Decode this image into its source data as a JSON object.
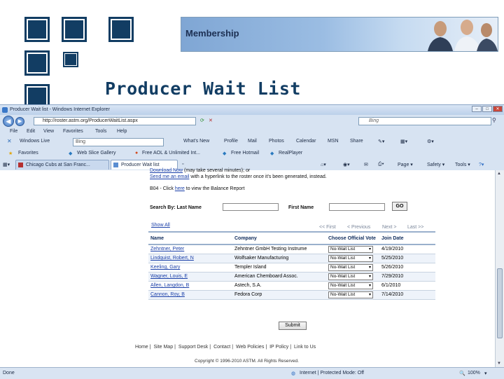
{
  "slide": {
    "banner_title": "Membership",
    "title": "Producer Wait List"
  },
  "browser": {
    "window_title": "Producer Wait list - Windows Internet Explorer",
    "address": "http://roster.astm.org/ProducerWaitList.aspx",
    "search_placeholder": "Bing",
    "menu": [
      "File",
      "Edit",
      "View",
      "Favorites",
      "Tools",
      "Help"
    ],
    "links_box": "Windows Live",
    "links_search": "Bing",
    "links": [
      "What's New",
      "Profile",
      "Mail",
      "Photos",
      "Calendar",
      "MSN",
      "Share"
    ],
    "favorites_label": "Favorites",
    "favorites": [
      "Web Slice Gallery",
      "Free AOL & Unlimited Int...",
      "Free Hotmail",
      "RealPlayer"
    ],
    "tabs": [
      "Chicago Cubs at San Franc...",
      "Producer Wait list"
    ],
    "commands": [
      "Page",
      "Safety",
      "Tools"
    ],
    "status_left": "Done",
    "status_zone": "Internet | Protected Mode: Off",
    "zoom": "100%"
  },
  "page": {
    "download_link": "Download Now",
    "download_text": " (may take several minutes); or",
    "email_link": "Send me an email",
    "email_text": " with a hyperlink to the roster once it's been generated, instead.",
    "b04_code": "B04",
    "balance_pre": " - Click ",
    "balance_link": "here",
    "balance_post": " to view the Balance Report",
    "search_label": "Search By: Last Name",
    "first_name_label": "First Name",
    "go_label": "GO",
    "show_all": "Show All",
    "pager": [
      "<< First",
      "< Previous",
      "Next >",
      "Last >>"
    ],
    "columns": [
      "Name",
      "Company",
      "Choose Official Vote",
      "Join Date"
    ],
    "rows": [
      {
        "name": "Zehntner, Peter",
        "company": "Zehntner GmbH Testing Instrume",
        "vote": "No-Wait List",
        "date": "4/19/2010"
      },
      {
        "name": "Lindquist, Robert, N",
        "company": "Wolfsaker Manufacturing",
        "vote": "No-Wait List",
        "date": "5/25/2010"
      },
      {
        "name": "Keeling, Gary",
        "company": "Templer Island",
        "vote": "No-Wait List",
        "date": "5/26/2010"
      },
      {
        "name": "Wagner, Louis, E",
        "company": "American Chemboard Assoc.",
        "vote": "No-Wait List",
        "date": "7/29/2010"
      },
      {
        "name": "Allen, Langdon, B",
        "company": "Astech, S.A.",
        "vote": "No-Wait List",
        "date": "6/1/2010"
      },
      {
        "name": "Cannon, Roy, B",
        "company": "Fedora Corp",
        "vote": "No-Wait List",
        "date": "7/14/2010"
      }
    ],
    "submit_label": "Submit",
    "footer_links": [
      "Home",
      "Site Map",
      "Support Desk",
      "Contact",
      "Web Policies",
      "IP Policy",
      "Link to Us"
    ],
    "copyright": "Copyright © 1996-2010 ASTM. All Rights Reserved."
  },
  "colors": {
    "brand_navy": "#123d63",
    "link_blue": "#1a3fa8"
  }
}
